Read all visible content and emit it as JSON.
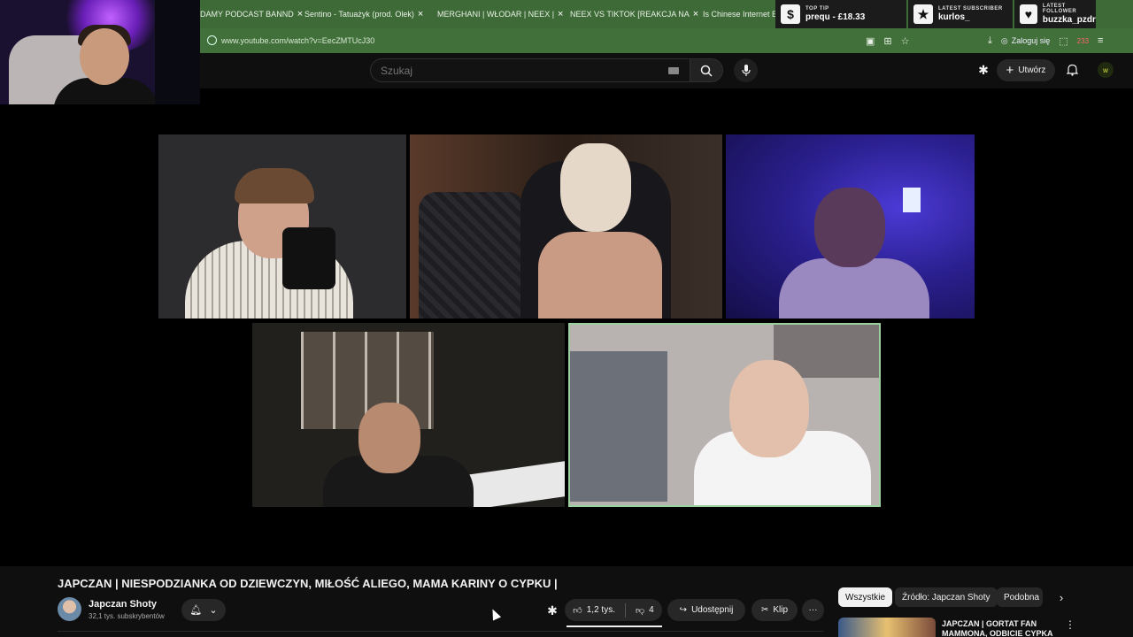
{
  "browser": {
    "tabs": [
      {
        "label": "DAMY PODCAST BANND"
      },
      {
        "label": "Sentino - Tatuażyk (prod. Olek)"
      },
      {
        "label": "MERGHANI | WŁODAR | NEEX |"
      },
      {
        "label": "NEEX VS TIKTOK [REAKCJA NA"
      },
      {
        "label": "Is Chinese Internet Ev"
      }
    ],
    "url": "www.youtube.com/watch?v=EecZMTUcJ30",
    "login_label": "Zaloguj się",
    "ext_badge": "233"
  },
  "stream_overlay": {
    "top_tip": {
      "label": "TOP TIP",
      "value": "prequ - £18.33",
      "icon": "money-bag-icon"
    },
    "latest_subscriber": {
      "label": "LATEST SUBSCRIBER",
      "value": "kurlos_",
      "icon": "star-icon"
    },
    "latest_follower": {
      "label": "LATEST FOLLOWER",
      "value": "buzzka_pzdr",
      "icon": "heart-icon"
    }
  },
  "youtube": {
    "search_placeholder": "Szukaj",
    "create_label": "Utwórz",
    "avatar_letter": "w"
  },
  "video": {
    "title": "JAPCZAN | NIESPODZIANKA OD DZIEWCZYN, MIŁOŚĆ ALIEGO, MAMA KARINY O CYPKU |",
    "channel_name": "Japczan Shoty",
    "subscribers": "32,1 tys. subskrybentów",
    "likes": "1,2 tys.",
    "dislikes": "4",
    "share_label": "Udostępnij",
    "clip_label": "Klip"
  },
  "sidebar": {
    "chips": [
      "Wszystkie",
      "Źródło: Japczan Shoty",
      "Podobna"
    ],
    "active_chip": "Wszystkie",
    "recommended_title": "JAPCZAN | GORTAT FAN MAMMONA, ODBICIE CYPKA"
  },
  "colors": {
    "tabbar": "#3d6a37",
    "page_bg": "#0f0f0f",
    "pill_bg": "#272727"
  }
}
